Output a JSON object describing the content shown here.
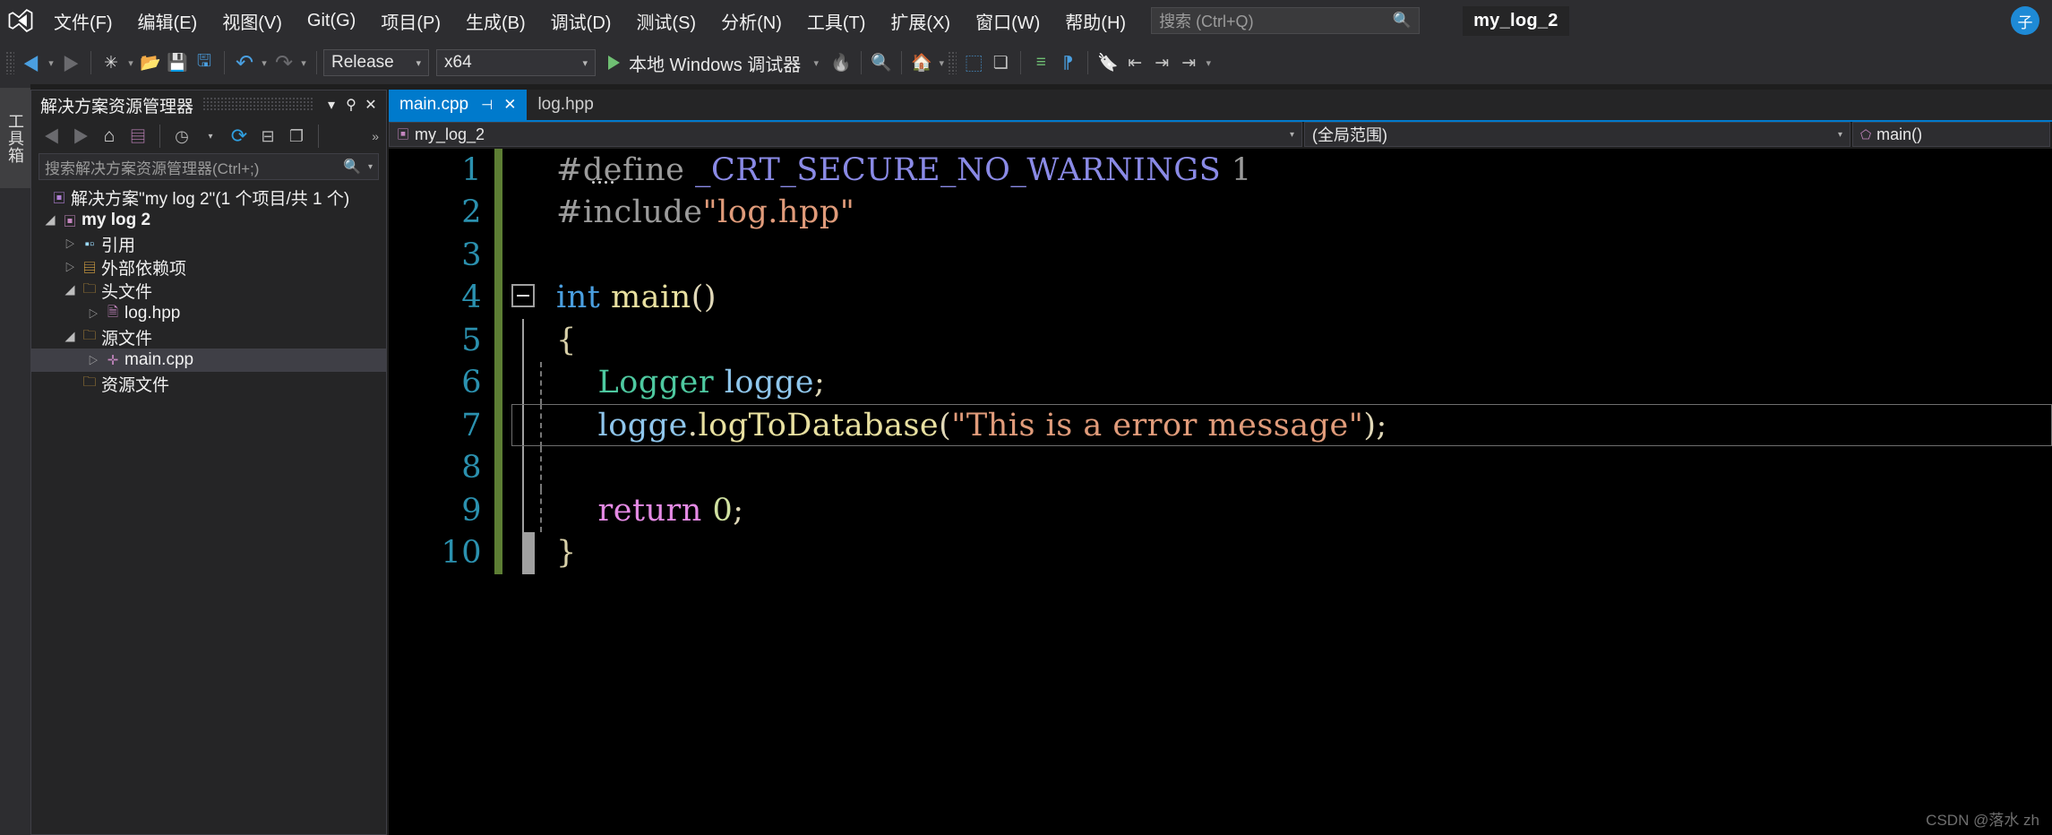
{
  "app": {
    "logo_icon": "visual-studio-logo",
    "project_badge": "my_log_2",
    "avatar_initial": "子",
    "watermark": "CSDN @落水 zh"
  },
  "menu": {
    "items": [
      {
        "label": "文件(F)"
      },
      {
        "label": "编辑(E)"
      },
      {
        "label": "视图(V)"
      },
      {
        "label": "Git(G)"
      },
      {
        "label": "项目(P)"
      },
      {
        "label": "生成(B)"
      },
      {
        "label": "调试(D)"
      },
      {
        "label": "测试(S)"
      },
      {
        "label": "分析(N)"
      },
      {
        "label": "工具(T)"
      },
      {
        "label": "扩展(X)"
      },
      {
        "label": "窗口(W)"
      },
      {
        "label": "帮助(H)"
      }
    ],
    "search": {
      "placeholder": "搜索 (Ctrl+Q)",
      "icon": "search-icon"
    }
  },
  "toolbar": {
    "nav_back": "◀",
    "nav_back_caret": "▾",
    "nav_forward": "▶",
    "new_item": "✳",
    "new_item_caret": "▾",
    "open_file": "📂",
    "save": "💾",
    "save_all": "🖫",
    "undo": "↶",
    "undo_caret": "▾",
    "redo": "↷",
    "redo_caret": "▾",
    "config": {
      "value": "Release",
      "caret": "▾"
    },
    "platform": {
      "value": "x64",
      "caret": "▾"
    },
    "run_label": "本地 Windows 调试器",
    "run_caret": "▾",
    "hot_reload": "🔥",
    "find_in_files": "🔍",
    "home": "🏠",
    "home_caret": "▾",
    "select_element": "⬚",
    "copy_panel": "❏",
    "indent_a": "≡",
    "indent_b": "⁋",
    "bookmark": "🔖",
    "bm_prev": "⇤",
    "bm_next": "⇥",
    "bm_clear": "⇥",
    "overflow": "▾"
  },
  "rail": {
    "toolbox_label": "工具箱"
  },
  "solution_explorer": {
    "title": "解决方案资源管理器",
    "header_buttons": {
      "dropdown": "▾",
      "pin": "⚲",
      "close": "✕"
    },
    "toolbar_icons": [
      {
        "name": "back-icon",
        "glyph": "◀"
      },
      {
        "name": "forward-icon",
        "glyph": "▶"
      },
      {
        "name": "home-icon",
        "glyph": "⌂"
      },
      {
        "name": "solution-icon",
        "glyph": "▤"
      },
      {
        "name": "pending-changes-icon",
        "glyph": "◷"
      },
      {
        "name": "pending-caret-icon",
        "glyph": "▾"
      },
      {
        "name": "refresh-icon",
        "glyph": "⟳"
      },
      {
        "name": "collapse-all-icon",
        "glyph": "⊟"
      },
      {
        "name": "properties-icon",
        "glyph": "❐"
      }
    ],
    "overflow": "»",
    "search": {
      "placeholder": "搜索解决方案资源管理器(Ctrl+;)",
      "icon": "search-icon",
      "caret": "▾"
    },
    "tree": [
      {
        "arrow": "",
        "icon": "▣",
        "label": "解决方案\"my log 2\"(1 个项目/共 1 个)",
        "indent": 14,
        "bold": false,
        "selected": false,
        "icon_color": "#b180d7"
      },
      {
        "arrow": "◢",
        "icon": "▣",
        "label": "my log 2",
        "indent": 30,
        "bold": true,
        "selected": false,
        "icon_color": "#c586c0"
      },
      {
        "arrow": "▷",
        "icon": "▪▫",
        "label": "引用",
        "indent": 52,
        "bold": false,
        "selected": false,
        "icon_color": "#9cdcfe"
      },
      {
        "arrow": "▷",
        "icon": "▤",
        "label": "外部依赖项",
        "indent": 52,
        "bold": false,
        "selected": false,
        "icon_color": "#d9a441"
      },
      {
        "arrow": "◢",
        "icon": "🗀",
        "label": "头文件",
        "indent": 52,
        "bold": false,
        "selected": false,
        "icon_color": "#d9a441"
      },
      {
        "arrow": "▷",
        "icon": "🗎",
        "label": "log.hpp",
        "indent": 78,
        "bold": false,
        "selected": false,
        "icon_color": "#c586c0"
      },
      {
        "arrow": "◢",
        "icon": "🗀",
        "label": "源文件",
        "indent": 52,
        "bold": false,
        "selected": false,
        "icon_color": "#d9a441"
      },
      {
        "arrow": "▷",
        "icon": "✛",
        "label": "main.cpp",
        "indent": 78,
        "bold": false,
        "selected": true,
        "icon_color": "#c586c0"
      },
      {
        "arrow": "",
        "icon": "🗀",
        "label": "资源文件",
        "indent": 52,
        "bold": false,
        "selected": false,
        "icon_color": "#d9a441"
      }
    ]
  },
  "editor": {
    "tabs": [
      {
        "label": "main.cpp",
        "active": true,
        "pin": "⊣",
        "close": "✕"
      },
      {
        "label": "log.hpp",
        "active": false,
        "pin": "",
        "close": ""
      }
    ],
    "navbar": {
      "project": {
        "icon": "project-icon",
        "label": "my_log_2",
        "caret": "▾"
      },
      "scope": {
        "label": "(全局范围)",
        "caret": "▾"
      },
      "member": {
        "icon": "method-icon",
        "label": "main()"
      }
    },
    "lines": [
      {
        "n": "1",
        "tokens": [
          {
            "t": "#define ",
            "c": "c-pp"
          },
          {
            "t": "_CRT_SECURE_NO_WARNINGS ",
            "c": "c-mac"
          },
          {
            "t": "1",
            "c": "c-pp"
          }
        ]
      },
      {
        "n": "2",
        "tokens": [
          {
            "t": "#include",
            "c": "c-pp"
          },
          {
            "t": "\"log.hpp\"",
            "c": "c-str"
          }
        ]
      },
      {
        "n": "3",
        "tokens": []
      },
      {
        "n": "4",
        "tokens": [
          {
            "t": "int ",
            "c": "c-kw"
          },
          {
            "t": "main",
            "c": "c-fn"
          },
          {
            "t": "()",
            "c": "c-plain"
          }
        ]
      },
      {
        "n": "5",
        "tokens": [
          {
            "t": "{",
            "c": "c-brace"
          }
        ]
      },
      {
        "n": "6",
        "tokens": [
          {
            "t": "    Logger ",
            "c": "c-type"
          },
          {
            "t": "logge",
            "c": "c-var"
          },
          {
            "t": ";",
            "c": "c-plain"
          }
        ]
      },
      {
        "n": "7",
        "tokens": [
          {
            "t": "    logge",
            "c": "c-var"
          },
          {
            "t": ".",
            "c": "c-plain"
          },
          {
            "t": "logToDatabase",
            "c": "c-fn"
          },
          {
            "t": "(",
            "c": "c-plain"
          },
          {
            "t": "\"This is a error message\"",
            "c": "c-str"
          },
          {
            "t": ");",
            "c": "c-plain"
          }
        ]
      },
      {
        "n": "8",
        "tokens": []
      },
      {
        "n": "9",
        "tokens": [
          {
            "t": "    return ",
            "c": "c-ret"
          },
          {
            "t": "0",
            "c": "c-num"
          },
          {
            "t": ";",
            "c": "c-plain"
          }
        ]
      },
      {
        "n": "10",
        "tokens": [
          {
            "t": "}",
            "c": "c-brace"
          }
        ]
      }
    ],
    "selected_line_index": 6,
    "fold_line_index": 3,
    "changebar_color": "#5d7e34",
    "linenumber_color": "#2b91af"
  }
}
